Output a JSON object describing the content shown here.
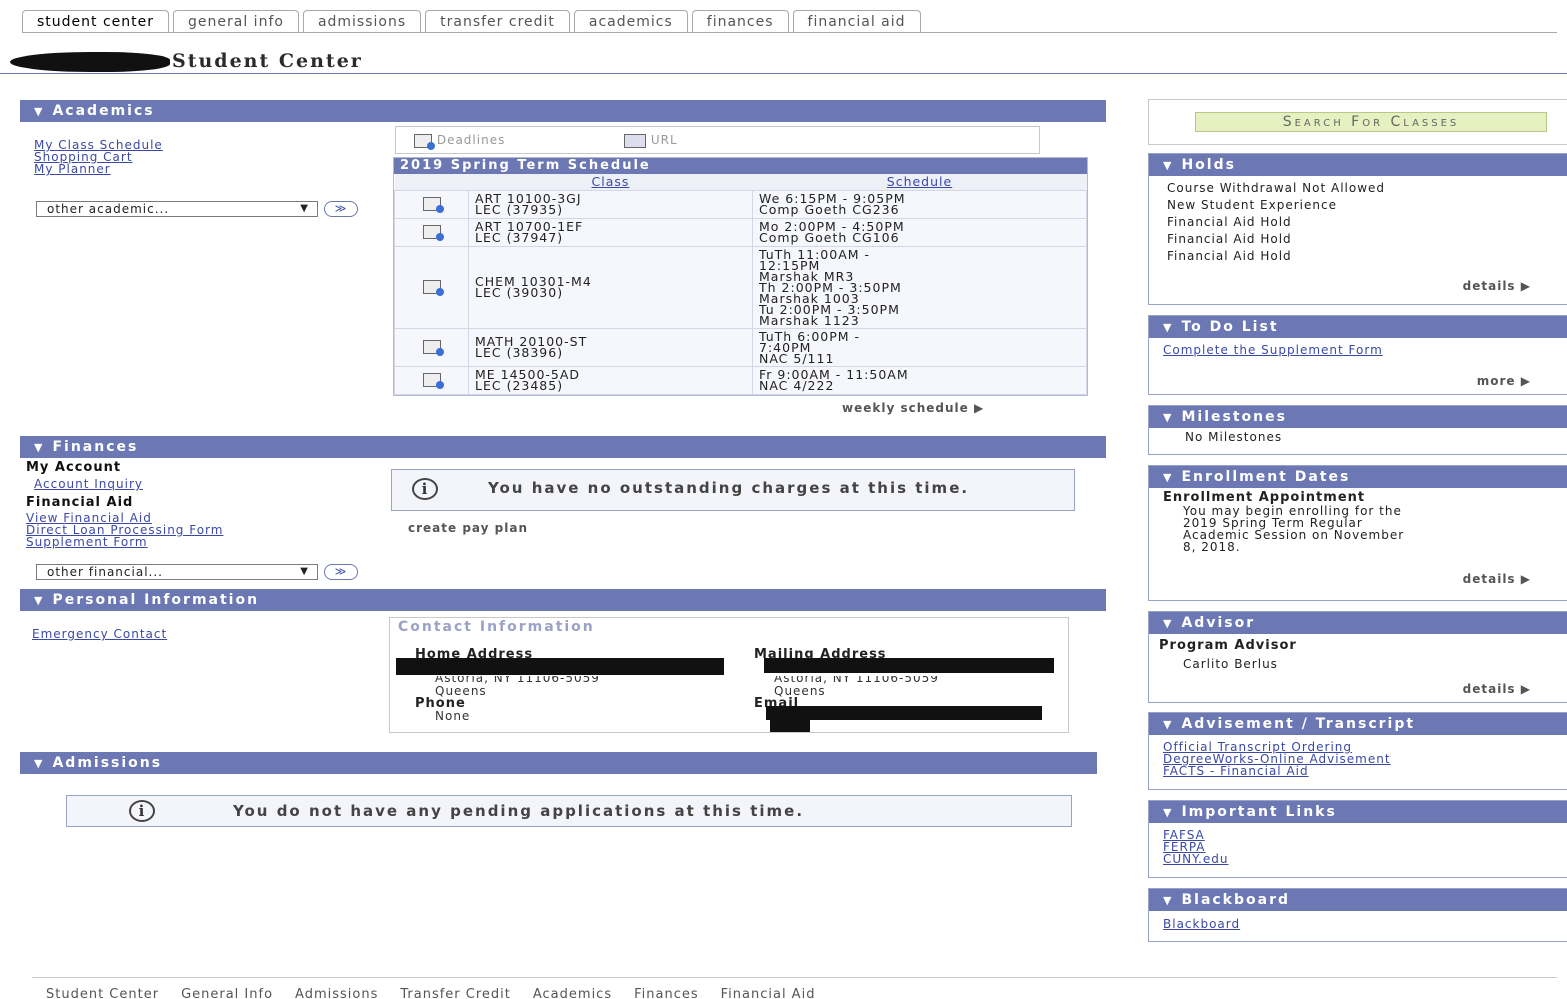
{
  "tabs": [
    "student center",
    "general info",
    "admissions",
    "transfer credit",
    "academics",
    "finances",
    "financial aid"
  ],
  "page_title": "Student Center",
  "academics": {
    "header": "Academics",
    "links": [
      "My Class Schedule",
      "Shopping Cart",
      "My Planner"
    ],
    "dropdown": "other academic...",
    "deadlines_label": "Deadlines",
    "url_label": "URL",
    "schedule_title": "2019 Spring Term Schedule",
    "col_class": "Class",
    "col_schedule": "Schedule",
    "rows": [
      {
        "class1": "ART 10100-3GJ",
        "class2": "LEC (37935)",
        "sched": [
          "We 6:15PM - 9:05PM",
          "Comp Goeth CG236"
        ]
      },
      {
        "class1": "ART 10700-1EF",
        "class2": "LEC (37947)",
        "sched": [
          "Mo 2:00PM - 4:50PM",
          "Comp Goeth CG106"
        ]
      },
      {
        "class1": "CHEM 10301-M4",
        "class2": "LEC (39030)",
        "sched": [
          "TuTh 11:00AM -",
          "12:15PM",
          "Marshak MR3",
          "Th 2:00PM - 3:50PM",
          "Marshak 1003",
          "Tu 2:00PM - 3:50PM",
          "Marshak 1123"
        ]
      },
      {
        "class1": "MATH 20100-ST",
        "class2": "LEC (38396)",
        "sched": [
          "TuTh 6:00PM -",
          "7:40PM",
          "NAC 5/111"
        ]
      },
      {
        "class1": "ME 14500-5AD",
        "class2": "LEC (23485)",
        "sched": [
          "Fr 9:00AM - 11:50AM",
          "NAC 4/222"
        ]
      }
    ],
    "weekly": "weekly schedule"
  },
  "finances": {
    "header": "Finances",
    "my_account": "My Account",
    "account_inquiry": "Account Inquiry",
    "financial_aid": "Financial Aid",
    "aid_links": [
      "View Financial Aid",
      "Direct Loan Processing Form",
      "Supplement Form"
    ],
    "dropdown": "other financial...",
    "notice": "You have no outstanding charges at this time.",
    "pay_plan": "create pay plan"
  },
  "personal": {
    "header": "Personal Information",
    "emergency": "Emergency Contact",
    "contact_title": "Contact Information",
    "home_label": "Home Address",
    "mailing_label": "Mailing Address",
    "home_city": "Astoria, NY 11106-5059",
    "home_county": "Queens",
    "mail_city": "Astoria, NY 11106-5059",
    "mail_county": "Queens",
    "phone_label": "Phone",
    "phone_value": "None",
    "email_label": "Email"
  },
  "admissions": {
    "header": "Admissions",
    "notice": "You do not have any pending applications at this time."
  },
  "right": {
    "search_button": "Search For Classes",
    "holds": {
      "header": "Holds",
      "items": [
        "Course Withdrawal Not Allowed",
        "New Student Experience",
        "Financial Aid Hold",
        "Financial Aid Hold",
        "Financial Aid Hold"
      ],
      "details": "details"
    },
    "todo": {
      "header": "To Do List",
      "item": "Complete the Supplement Form",
      "more": "more"
    },
    "milestones": {
      "header": "Milestones",
      "text": "No Milestones"
    },
    "enrollment": {
      "header": "Enrollment Dates",
      "label": "Enrollment Appointment",
      "lines": [
        "You may begin enrolling for the",
        "2019 Spring Term Regular",
        "Academic Session on November",
        "8, 2018."
      ],
      "details": "details"
    },
    "advisor": {
      "header": "Advisor",
      "label": "Program Advisor",
      "name": "Carlito Berlus",
      "details": "details"
    },
    "advisement": {
      "header": "Advisement / Transcript",
      "links": [
        "Official Transcript Ordering",
        "DegreeWorks-Online Advisement",
        "FACTS - Financial Aid"
      ]
    },
    "important": {
      "header": "Important Links",
      "links": [
        "FAFSA",
        "FERPA",
        "CUNY.edu"
      ]
    },
    "blackboard": {
      "header": "Blackboard",
      "link": "Blackboard"
    }
  },
  "footer": [
    "Student Center",
    "General Info",
    "Admissions",
    "Transfer Credit",
    "Academics",
    "Finances",
    "Financial Aid"
  ]
}
